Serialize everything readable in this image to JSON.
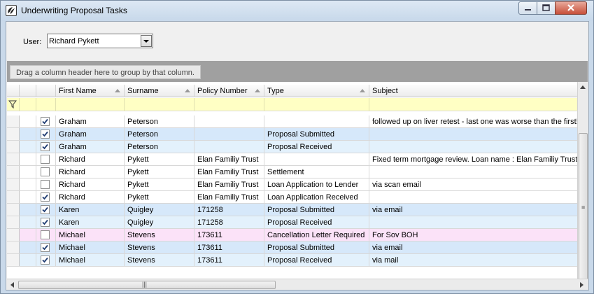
{
  "window": {
    "title": "Underwriting Proposal Tasks"
  },
  "user": {
    "label": "User:",
    "value": "Richard Pykett"
  },
  "group_panel": {
    "hint": "Drag a column header here to group by that column."
  },
  "columns": [
    "First Name",
    "Surname",
    "Policy Number",
    "Type",
    "Subject"
  ],
  "rows": [
    {
      "checked": true,
      "first": "Graham",
      "surname": "Peterson",
      "policy": "",
      "type": "",
      "subject": "followed up on liver retest - last one was worse than the first!",
      "color": "white"
    },
    {
      "checked": true,
      "first": "Graham",
      "surname": "Peterson",
      "policy": "",
      "type": "Proposal Submitted",
      "subject": "",
      "color": "blue"
    },
    {
      "checked": true,
      "first": "Graham",
      "surname": "Peterson",
      "policy": "",
      "type": "Proposal Received",
      "subject": "",
      "color": "lblue"
    },
    {
      "checked": false,
      "first": "Richard",
      "surname": "Pykett",
      "policy": "Elan Familiy Trust",
      "type": "",
      "subject": "Fixed term mortgage review.  Loan name : Elan Familiy Trust",
      "color": "white"
    },
    {
      "checked": false,
      "first": "Richard",
      "surname": "Pykett",
      "policy": "Elan Familiy Trust",
      "type": "Settlement",
      "subject": "",
      "color": "white"
    },
    {
      "checked": false,
      "first": "Richard",
      "surname": "Pykett",
      "policy": "Elan Familiy Trust",
      "type": "Loan Application to Lender",
      "subject": "via scan email",
      "color": "white"
    },
    {
      "checked": true,
      "first": "Richard",
      "surname": "Pykett",
      "policy": "Elan Familiy Trust",
      "type": "Loan Application Received",
      "subject": "",
      "color": "white"
    },
    {
      "checked": true,
      "first": "Karen",
      "surname": "Quigley",
      "policy": "171258",
      "type": "Proposal Submitted",
      "subject": "via email",
      "color": "blue"
    },
    {
      "checked": true,
      "first": "Karen",
      "surname": "Quigley",
      "policy": "171258",
      "type": "Proposal Received",
      "subject": "",
      "color": "lblue"
    },
    {
      "checked": false,
      "first": "Michael",
      "surname": "Stevens",
      "policy": "173611",
      "type": "Cancellation Letter Required",
      "subject": "For Sov BOH",
      "color": "pink"
    },
    {
      "checked": true,
      "first": "Michael",
      "surname": "Stevens",
      "policy": "173611",
      "type": "Proposal Submitted",
      "subject": "via email",
      "color": "blue"
    },
    {
      "checked": true,
      "first": "Michael",
      "surname": "Stevens",
      "policy": "173611",
      "type": "Proposal Received",
      "subject": "via mail",
      "color": "lblue"
    }
  ],
  "icons": {
    "app": "app-logo-icon",
    "minimize": "minimize-icon",
    "maximize": "maximize-icon",
    "close": "close-icon",
    "dropdown": "chevron-down-icon",
    "filter": "filter-icon",
    "sort": "sort-arrow-icon"
  },
  "colors": {
    "row_white": "#ffffff",
    "row_blue": "#d6e8fa",
    "row_light_blue": "#e3f1fc",
    "row_pink": "#fbe2f8",
    "filter_row": "#ffffc4"
  }
}
